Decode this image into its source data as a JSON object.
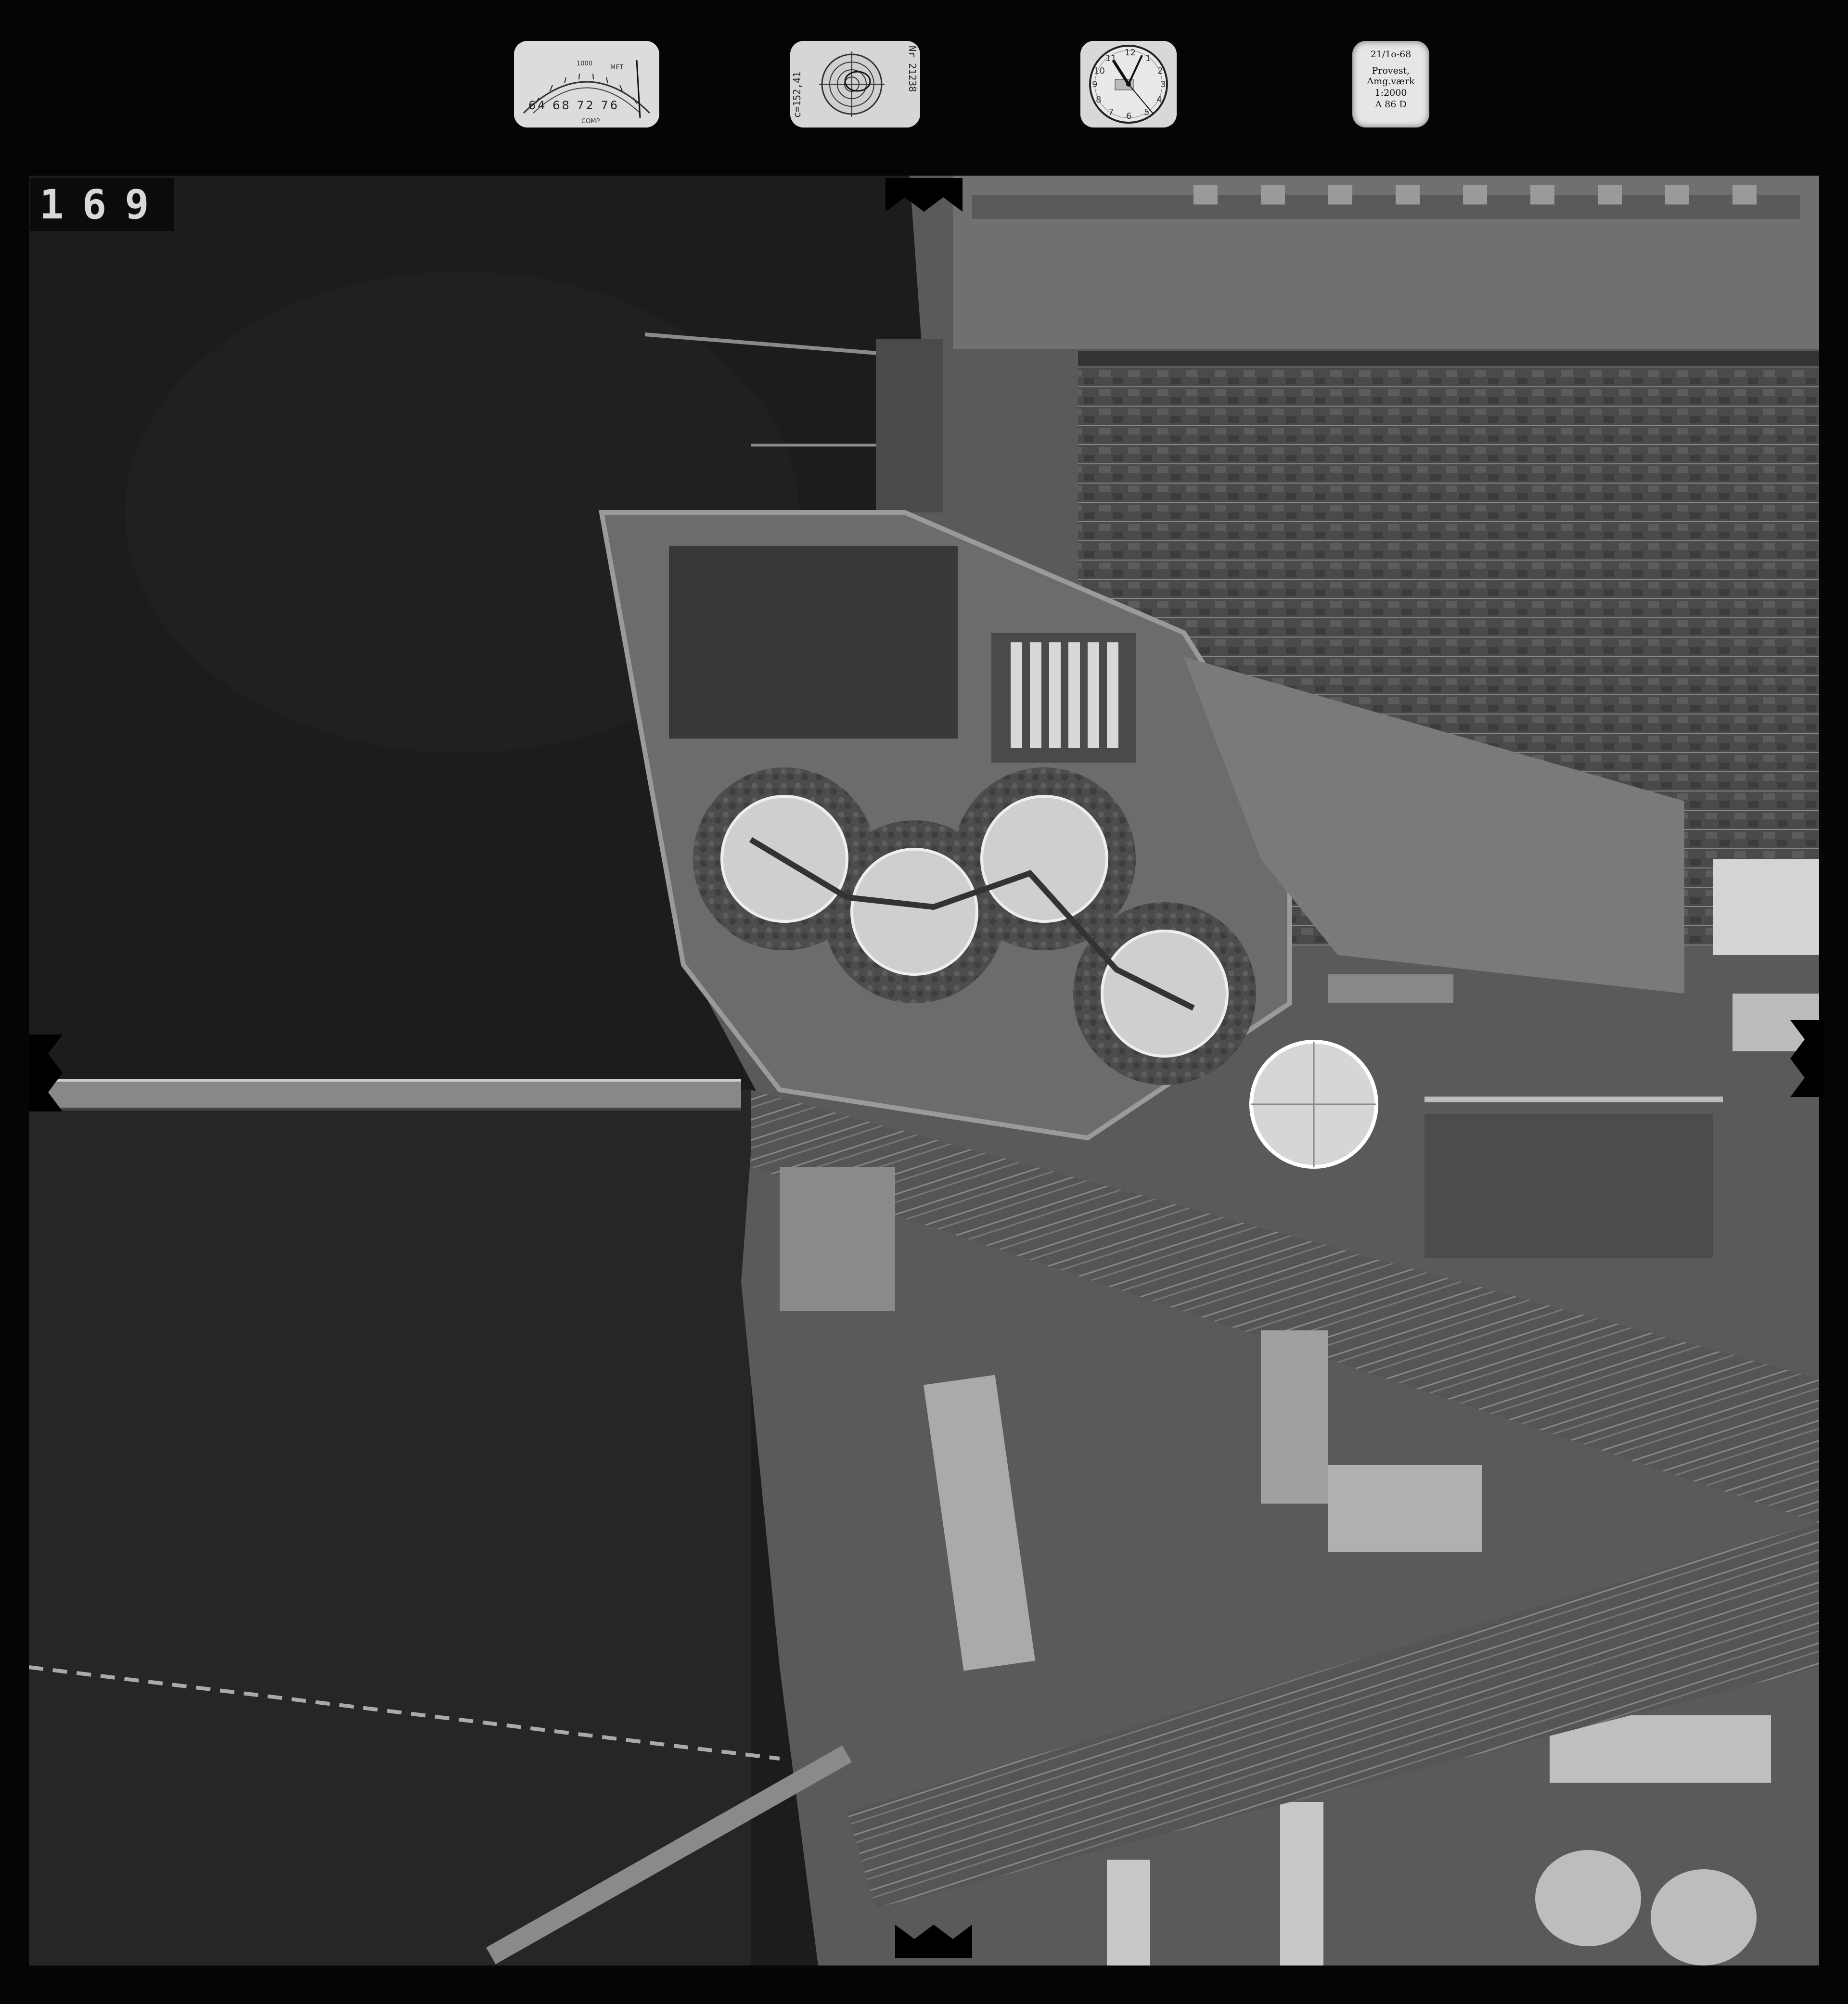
{
  "frame_number": "169",
  "instruments": {
    "altimeter": {
      "scale": "64  68  72  76",
      "top_label_left": "1000",
      "top_label_right": "MET",
      "bottom_label": "COMP"
    },
    "focal_length": "c=152,41",
    "camera_serial": "Nr 21238",
    "clock": {
      "icon": "clock-icon",
      "hour_numerals": [
        "12",
        "1",
        "2",
        "3",
        "4",
        "5",
        "6",
        "7",
        "8",
        "9",
        "10",
        "11"
      ]
    },
    "data_card": {
      "date": "21/1o-68",
      "line2": "Provest,",
      "line3": "Amg.værk",
      "scale": "1:2000",
      "id": "A 86 D"
    }
  },
  "photo": {
    "icon": "aerial-photo-icon"
  },
  "colors": {
    "film_border": "#050505",
    "water": "#1e1e1e",
    "land": "#6e6e6e",
    "tanks": "#cfcfcf"
  }
}
